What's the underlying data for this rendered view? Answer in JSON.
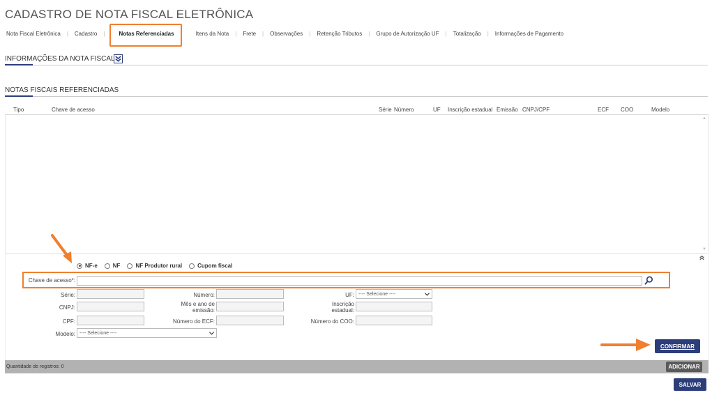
{
  "page": {
    "title": "CADASTRO DE NOTA FISCAL ELETRÔNICA"
  },
  "tabs": [
    {
      "label": "Nota Fiscal Eletrônica"
    },
    {
      "label": "Cadastro"
    },
    {
      "label": "Notas Referenciadas",
      "active": true
    },
    {
      "label": "Itens da Nota"
    },
    {
      "label": "Frete"
    },
    {
      "label": "Observações"
    },
    {
      "label": "Retenção Tributos"
    },
    {
      "label": "Grupo de Autorização UF"
    },
    {
      "label": "Totalização"
    },
    {
      "label": "Informações de Pagamento"
    }
  ],
  "sections": {
    "info": "INFORMAÇÕES DA NOTA FISCAL",
    "referenced": "NOTAS FISCAIS REFERENCIADAS"
  },
  "grid": {
    "columns": [
      "Tipo",
      "Chave de acesso",
      "Série",
      "Número",
      "UF",
      "Inscrição estadual",
      "Emissão",
      "CNPJ/CPF",
      "ECF",
      "COO",
      "Modelo"
    ]
  },
  "form": {
    "radios": [
      "NF-e",
      "NF",
      "NF Produtor rural",
      "Cupom fiscal"
    ],
    "chave_label": "Chave de acesso*:",
    "serie_label": "Série:",
    "numero_label": "Número:",
    "uf_label": "UF:",
    "uf_value": "---- Selecione ----",
    "cnpj_label": "CNPJ:",
    "mes_ano_label": "Mês e ano de emissão:",
    "inscricao_label": "Inscrição estadual:",
    "cpf_label": "CPF:",
    "numero_ecf_label": "Número do ECF:",
    "numero_coo_label": "Número do COO:",
    "modelo_label": "Modelo:",
    "modelo_value": "---- Selecione ----"
  },
  "buttons": {
    "confirmar": "CONFIRMAR",
    "adicionar": "ADICIONAR",
    "salvar": "SALVAR"
  },
  "footer": {
    "records": "Quantidade de registros: 0"
  },
  "colors": {
    "accent": "#2c3e7a",
    "highlight": "#f07f2f"
  }
}
